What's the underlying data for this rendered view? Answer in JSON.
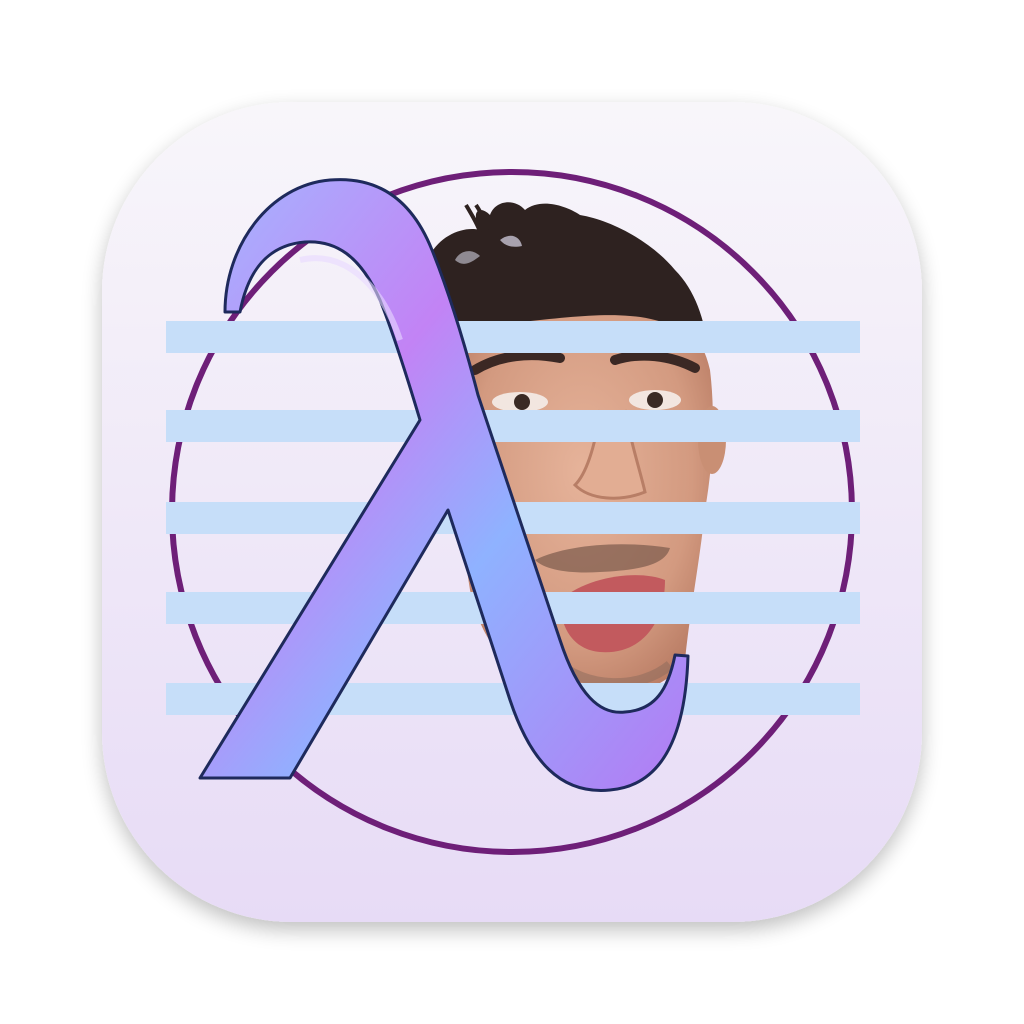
{
  "icon": {
    "subject": "app-icon",
    "glyph": "λ",
    "colors": {
      "tile_top": "#f7f5fa",
      "tile_bottom": "#e8dcf7",
      "ring": "#6e1f78",
      "stripe": "#c6def9",
      "lambda_blue": "#8ab0ff",
      "lambda_violet": "#c27bf3",
      "lambda_outline": "#1e2a5c",
      "skin": "#d9a48c",
      "hair": "#2e2220"
    },
    "stripe_count": 5
  }
}
